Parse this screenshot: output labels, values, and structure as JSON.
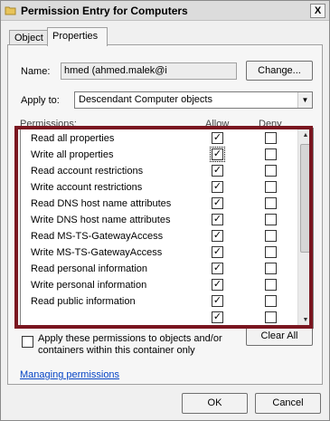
{
  "window": {
    "title": "Permission Entry for Computers",
    "close_glyph": "X"
  },
  "tabs": [
    {
      "label": "Object"
    },
    {
      "label": "Properties"
    }
  ],
  "name_label": "Name:",
  "name_value": "hmed (ahmed.malek@i",
  "change_button": "Change...",
  "apply_to_label": "Apply to:",
  "apply_to_value": "Descendant Computer objects",
  "permissions_header": "Permissions:",
  "allow_header": "Allow",
  "deny_header": "Deny",
  "permissions": [
    {
      "name": "Read all properties",
      "allow": true,
      "deny": false
    },
    {
      "name": "Write all properties",
      "allow": true,
      "deny": false
    },
    {
      "name": "Read account restrictions",
      "allow": true,
      "deny": false
    },
    {
      "name": "Write account restrictions",
      "allow": true,
      "deny": false
    },
    {
      "name": "Read DNS host name attributes",
      "allow": true,
      "deny": false
    },
    {
      "name": "Write DNS host name attributes",
      "allow": true,
      "deny": false
    },
    {
      "name": "Read MS-TS-GatewayAccess",
      "allow": true,
      "deny": false
    },
    {
      "name": "Write MS-TS-GatewayAccess",
      "allow": true,
      "deny": false
    },
    {
      "name": "Read personal information",
      "allow": true,
      "deny": false
    },
    {
      "name": "Write personal information",
      "allow": true,
      "deny": false
    },
    {
      "name": "Read public information",
      "allow": true,
      "deny": false
    }
  ],
  "apply_checkbox_label": "Apply these permissions to objects and/or containers within this container only",
  "clear_all_button": "Clear All",
  "managing_permissions_link": "Managing permissions",
  "ok_button": "OK",
  "cancel_button": "Cancel",
  "colors": {
    "highlight_border": "#7a1620",
    "link": "#0645c6"
  },
  "icons": {
    "title": "folder-icon",
    "check_glyph": "✓",
    "scroll_up": "▲",
    "scroll_down": "▼",
    "dropdown": "▼"
  }
}
